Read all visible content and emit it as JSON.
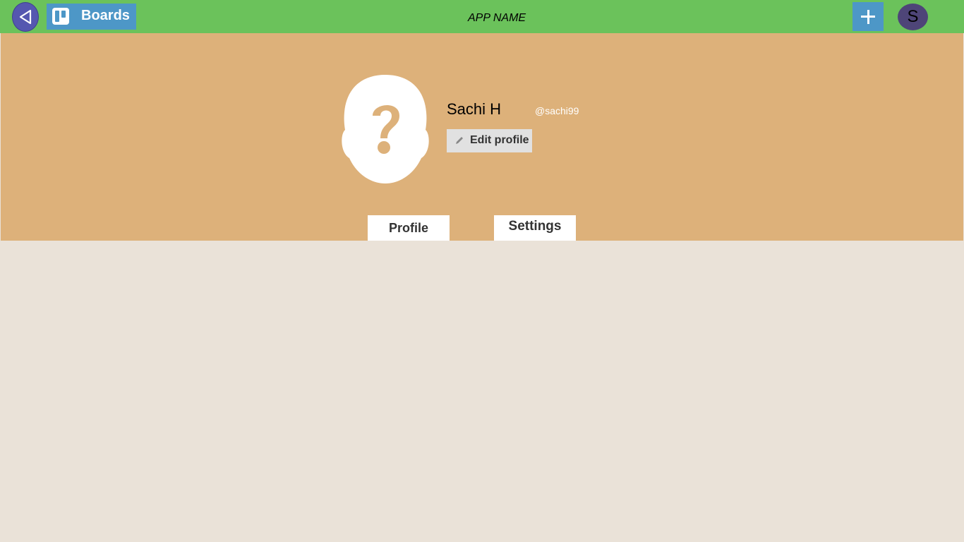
{
  "topbar": {
    "back_icon": "triangle-left-icon",
    "boards_label": "Boards",
    "boards_icon": "trello-board-icon",
    "app_name": "APP NAME",
    "add_icon": "plus-icon",
    "user_initial": "S",
    "colors": {
      "bar": "#6bc25b",
      "back": "#5557b0",
      "button": "#4d97c7",
      "avatar": "#4e4578"
    }
  },
  "profile": {
    "avatar_icon": "unknown-person-icon",
    "name": "Sachi H",
    "handle": "@sachi99",
    "edit_label": "Edit profile",
    "edit_icon": "pencil-icon",
    "header_color": "#ddb17a"
  },
  "tabs": [
    {
      "label": "Profile"
    },
    {
      "label": "Settings"
    }
  ]
}
